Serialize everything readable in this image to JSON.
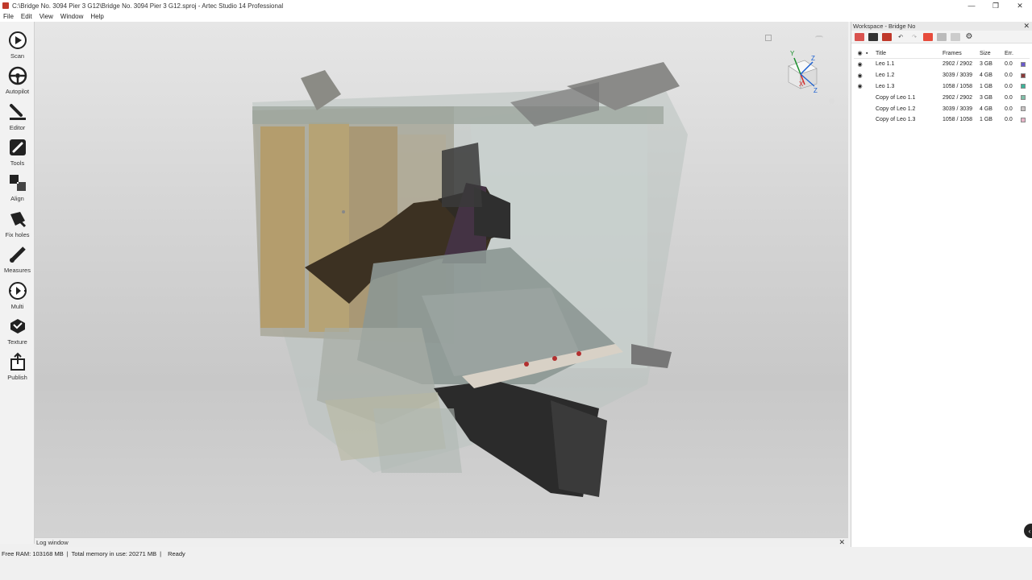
{
  "window": {
    "title": "C:\\Bridge No. 3094 Pier 3 G12\\Bridge No. 3094 Pier 3 G12.sproj - Artec Studio 14 Professional",
    "controls": [
      "—",
      "❐",
      "✕"
    ]
  },
  "menu": [
    "File",
    "Edit",
    "View",
    "Window",
    "Help"
  ],
  "toolbar": [
    {
      "label": "Scan",
      "icon": "scan-play-icon"
    },
    {
      "label": "Autopilot",
      "icon": "autopilot-icon"
    },
    {
      "label": "Editor",
      "icon": "editor-icon"
    },
    {
      "label": "Tools",
      "icon": "tools-icon"
    },
    {
      "label": "Align",
      "icon": "align-icon"
    },
    {
      "label": "Fix holes",
      "icon": "fix-holes-icon"
    },
    {
      "label": "Measures",
      "icon": "measures-icon"
    },
    {
      "label": "Multi",
      "icon": "multi-icon"
    },
    {
      "label": "Texture",
      "icon": "texture-icon"
    },
    {
      "label": "Publish",
      "icon": "publish-icon"
    }
  ],
  "log": {
    "label": "Log window",
    "close": "✕"
  },
  "status": {
    "free_ram": "Free RAM: 103168 MB",
    "sep1": "|",
    "total_memory": "Total memory in use: 20271 MB",
    "sep2": "|",
    "state": "Ready"
  },
  "workspace": {
    "title": "Workspace - Bridge No",
    "close": "✕",
    "columns": {
      "title": "Title",
      "frames": "Frames",
      "size": "Size",
      "err": "Err."
    },
    "rows": [
      {
        "title": "Leo 1.1",
        "frames": "2902 / 2902",
        "size": "3 GB",
        "err": "0.0",
        "visible": true,
        "color": "#6a5acd"
      },
      {
        "title": "Leo 1.2",
        "frames": "3039 / 3039",
        "size": "4 GB",
        "err": "0.0",
        "visible": true,
        "color": "#8b3a3a"
      },
      {
        "title": "Leo 1.3",
        "frames": "1058 / 1058",
        "size": "1 GB",
        "err": "0.0",
        "visible": true,
        "color": "#3cb39a"
      },
      {
        "title": "Copy of Leo 1.1",
        "frames": "2902 / 2902",
        "size": "3 GB",
        "err": "0.0",
        "visible": false,
        "color": "#7fbfa8"
      },
      {
        "title": "Copy of Leo 1.2",
        "frames": "3039 / 3039",
        "size": "4 GB",
        "err": "0.0",
        "visible": false,
        "color": "#c9c4c4"
      },
      {
        "title": "Copy of Leo 1.3",
        "frames": "1058 / 1058",
        "size": "1 GB",
        "err": "0.0",
        "visible": false,
        "color": "#e8b4c8"
      }
    ]
  },
  "gizmo": {
    "x_label": "X",
    "y_label": "Y",
    "z_label": "Z"
  }
}
